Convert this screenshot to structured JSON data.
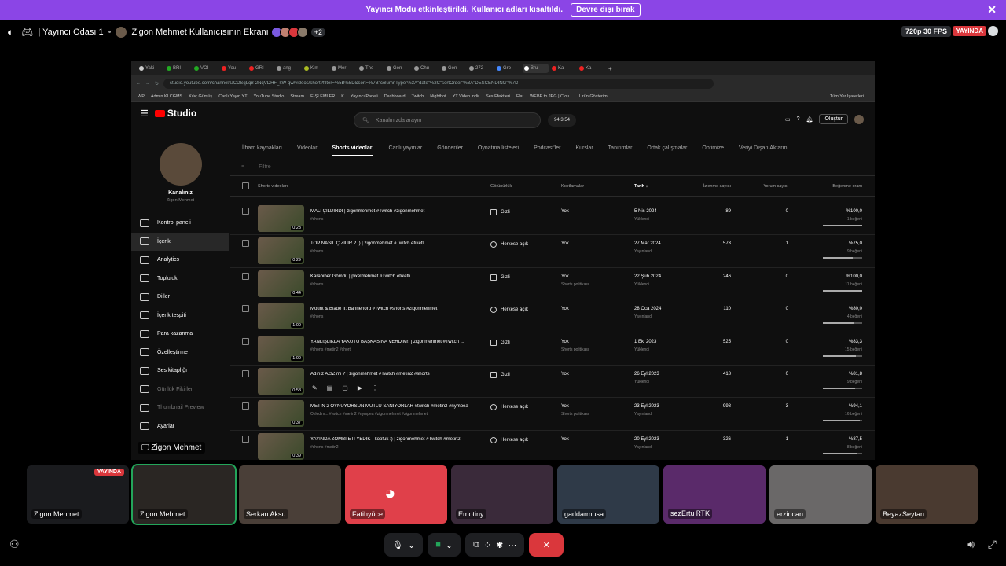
{
  "banner": {
    "text": "Yayıncı Modu etkinleştirildi. Kullanıcı adları kısaltıldı.",
    "button": "Devre dışı bırak"
  },
  "topbar": {
    "channel": "| Yayıncı Odası 1",
    "screen_title": "Zigon Mehmet Kullanıcısının Ekranı",
    "extra_count": "+2",
    "quality": "720p 30 FPS",
    "live_label": "YAYINDA"
  },
  "browser": {
    "url": "studio.youtube.com/channel/UCDSqLq8-2NqVDHF_kW-qw/videos/short?filter=%5B%5D&sort=%7B\"columnType\"%3A\"date\"%2C\"sortOrder\"%3A\"DESCENDING\"%7D",
    "tabs": [
      "Yaki",
      "BRI",
      "VOI",
      "You",
      "GRI",
      "ang",
      "Kim",
      "Mer",
      "The",
      "Gen",
      "Chu",
      "Gen",
      "272",
      "Gro",
      "Bru",
      "Ka",
      "Ka"
    ],
    "bookmarks": [
      "WP",
      "Admin KLCGMS",
      "Kılıç Gümüş",
      "Canlı Yayın YT",
      "YouTube Studio",
      "Stream",
      "E-ŞLEMLER",
      "K",
      "Yayıncı Paneli",
      "Dashboard",
      "Twitch",
      "Nightbot",
      "YT Video indir",
      "Ses Efektleri",
      "Flat",
      "WEBP to JPG | Clou...",
      "Ürün Gösterim"
    ],
    "bookmarks_right": "Tüm Yer İşaretleri"
  },
  "studio": {
    "logo": "Studio",
    "search_placeholder": "Kanalınızda arayın",
    "stats": "94  3  54",
    "create": "Oluştur",
    "channel_label": "Kanalınız",
    "channel_name": "Zigon Mehmet",
    "nav": [
      "Kontrol paneli",
      "İçerik",
      "Analytics",
      "Topluluk",
      "Diller",
      "İçerik tespiti",
      "Para kazanma",
      "Özelleştirme",
      "Ses kitaplığı",
      "Günlük Fikirler",
      "Thumbnail Preview",
      "Ayarlar"
    ],
    "tabs": [
      "İlham kaynakları",
      "Videolar",
      "Shorts videoları",
      "Canlı yayınlar",
      "Gönderiler",
      "Oynatma listeleri",
      "Podcast'ler",
      "Kurslar",
      "Tanıtımlar",
      "Ortak çalışmalar",
      "Optimize",
      "Veriyi Dışarı Aktarın"
    ],
    "filter": "Filtre",
    "headers": {
      "video": "Shorts videoları",
      "visibility": "Görünürlük",
      "restrictions": "Kısıtlamalar",
      "date": "Tarih ↓",
      "views": "İzlenme sayısı",
      "comments": "Yorum sayısı",
      "likes": "Beğenme oranı"
    },
    "rows": [
      {
        "title": "MALİ ÇILDIRDI | zigonmehmet #Twitch #zigonmehmet",
        "desc": "#shorts",
        "dur": "0:23",
        "vis": "Gizli",
        "res": "Yok",
        "res2": "",
        "date": "5 Nis 2024",
        "date2": "Yüklendi",
        "views": "89",
        "comments": "0",
        "likes": "%100,0",
        "likes2": "1 beğeni",
        "pct": 1.0
      },
      {
        "title": "TOP NASIL ÇİZİLİR ? :) | zigonmehmet #Twitch etiketli",
        "desc": "#shorts",
        "dur": "0:29",
        "vis": "Herkese açık",
        "res": "Yok",
        "res2": "",
        "date": "27 Mar 2024",
        "date2": "Yayınlandı",
        "views": "573",
        "comments": "1",
        "likes": "%75,0",
        "likes2": "9 beğeni",
        "pct": 0.75
      },
      {
        "title": "Karabiber Gömdü | pixelmehmet #Twitch etiketli",
        "desc": "#shorts",
        "dur": "0:44",
        "vis": "Gizli",
        "res": "Yok",
        "res2": "Shorts politikası",
        "date": "22 Şub 2024",
        "date2": "Yüklendi",
        "views": "246",
        "comments": "0",
        "likes": "%100,0",
        "likes2": "11 beğeni",
        "pct": 1.0
      },
      {
        "title": "Mount & Blade II: Bannerlord #Twitch #shorts #zigonmehmet",
        "desc": "#shorts",
        "dur": "1:00",
        "vis": "Herkese açık",
        "res": "Yok",
        "res2": "",
        "date": "28 Oca 2024",
        "date2": "Yayınlandı",
        "views": "110",
        "comments": "0",
        "likes": "%80,0",
        "likes2": "4 beğeni",
        "pct": 0.8
      },
      {
        "title": "YANLIŞLIKLA YAKUTU BAŞKASINA VERDİM!! | zigonmehmet #Twitch ...",
        "desc": "#shorts #metin2 #short",
        "dur": "1:00",
        "vis": "Gizli",
        "res": "Yok",
        "res2": "Shorts politikası",
        "date": "1 Eki 2023",
        "date2": "Yüklendi",
        "views": "525",
        "comments": "0",
        "likes": "%83,3",
        "likes2": "15 beğeni",
        "pct": 0.833
      },
      {
        "title": "Adınız AZİZ mi ? | zigonmehmet #Twitch #metin2 #shorts",
        "desc": "",
        "dur": "0:58",
        "vis": "Gizli",
        "res": "Yok",
        "res2": "",
        "date": "26 Eyl 2023",
        "date2": "Yüklendi",
        "views": "418",
        "comments": "0",
        "likes": "%81,8",
        "likes2": "9 beğeni",
        "pct": 0.818
      },
      {
        "title": "METİN 2 OYNUYORSUN MUTLU SANIYORLAR #twitch #metin2 #nympea",
        "desc": "Özledim... #twitch #metin2 #nympea #zigonmehmet #zigonmehmet",
        "dur": "0:37",
        "vis": "Herkese açık",
        "res": "Yok",
        "res2": "Shorts politikası",
        "date": "23 Eyl 2023",
        "date2": "Yayınlandı",
        "views": "998",
        "comments": "3",
        "likes": "%94,1",
        "likes2": "16 beğeni",
        "pct": 0.941
      },
      {
        "title": "YAYINDA ZOMBİ ETİ YEDİK - kopfuk :) | zigonmehmet #Twitch #metin2",
        "desc": "#shorts #metin2",
        "dur": "0:39",
        "vis": "Herkese açık",
        "res": "Yok",
        "res2": "",
        "date": "20 Eyl 2023",
        "date2": "Yayınlandı",
        "views": "326",
        "comments": "1",
        "likes": "%87,5",
        "likes2": "8 beğeni",
        "pct": 0.875
      }
    ],
    "owner": "Zigon Mehmet"
  },
  "participants": [
    {
      "name": "Zigon Mehmet",
      "color": "#1a1b1e",
      "live": "YAYINDA"
    },
    {
      "name": "Zigon Mehmet",
      "color": "#2a2623",
      "live": ""
    },
    {
      "name": "Serkan Aksu",
      "color": "#4a3f38",
      "live": ""
    },
    {
      "name": "Fatihyüce",
      "color": "#e0404a",
      "live": ""
    },
    {
      "name": "Emotiny",
      "color": "#3a2a3a",
      "live": ""
    },
    {
      "name": "gaddarmusa",
      "color": "#2f3a48",
      "live": ""
    },
    {
      "name": "sezErtu ᏒᎢᏦ",
      "color": "#5a2a6a",
      "live": ""
    },
    {
      "name": "erzincan",
      "color": "#6a6868",
      "live": ""
    },
    {
      "name": "BeyazSeytan",
      "color": "#4a3a30",
      "live": ""
    }
  ]
}
